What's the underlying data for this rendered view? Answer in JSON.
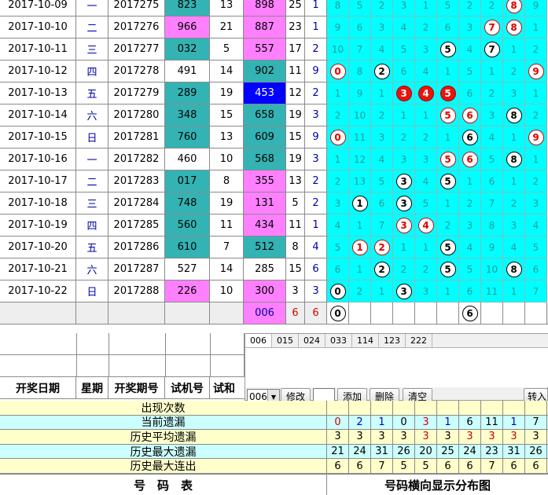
{
  "rows": [
    {
      "date": "2017-10-09",
      "weekday": "一",
      "issue": "2017275",
      "test": "823",
      "test_bg": "#33b3b3",
      "s1": "13",
      "win": "898",
      "win_bg": "#ff80ff",
      "s2": "25",
      "s3": "1"
    },
    {
      "date": "2017-10-10",
      "weekday": "二",
      "issue": "2017276",
      "test": "966",
      "test_bg": "#ff80ff",
      "s1": "21",
      "win": "887",
      "win_bg": "#ff80ff",
      "s2": "23",
      "s3": "1"
    },
    {
      "date": "2017-10-11",
      "weekday": "三",
      "issue": "2017277",
      "test": "032",
      "test_bg": "#33b3b3",
      "s1": "5",
      "win": "557",
      "win_bg": "#ff80ff",
      "s2": "17",
      "s3": "2"
    },
    {
      "date": "2017-10-12",
      "weekday": "四",
      "issue": "2017278",
      "test": "491",
      "test_bg": "#ffffff",
      "s1": "14",
      "win": "902",
      "win_bg": "#33b3b3",
      "s2": "11",
      "s3": "9"
    },
    {
      "date": "2017-10-13",
      "weekday": "五",
      "issue": "2017279",
      "test": "289",
      "test_bg": "#33b3b3",
      "s1": "19",
      "win": "453",
      "win_bg": "#0000ff",
      "s2": "12",
      "s3": "2"
    },
    {
      "date": "2017-10-14",
      "weekday": "六",
      "issue": "2017280",
      "test": "348",
      "test_bg": "#33b3b3",
      "s1": "15",
      "win": "658",
      "win_bg": "#33b3b3",
      "s2": "19",
      "s3": "3"
    },
    {
      "date": "2017-10-15",
      "weekday": "日",
      "issue": "2017281",
      "test": "760",
      "test_bg": "#33b3b3",
      "s1": "13",
      "win": "609",
      "win_bg": "#33b3b3",
      "s2": "15",
      "s3": "9"
    },
    {
      "date": "2017-10-16",
      "weekday": "一",
      "issue": "2017282",
      "test": "460",
      "test_bg": "#ffffff",
      "s1": "10",
      "win": "568",
      "win_bg": "#33b3b3",
      "s2": "19",
      "s3": "3"
    },
    {
      "date": "2017-10-17",
      "weekday": "二",
      "issue": "2017283",
      "test": "017",
      "test_bg": "#33b3b3",
      "s1": "8",
      "win": "355",
      "win_bg": "#ff80ff",
      "s2": "13",
      "s3": "2"
    },
    {
      "date": "2017-10-18",
      "weekday": "三",
      "issue": "2017284",
      "test": "748",
      "test_bg": "#33b3b3",
      "s1": "19",
      "win": "131",
      "win_bg": "#ff80ff",
      "s2": "5",
      "s3": "2"
    },
    {
      "date": "2017-10-19",
      "weekday": "四",
      "issue": "2017285",
      "test": "560",
      "test_bg": "#33b3b3",
      "s1": "11",
      "win": "434",
      "win_bg": "#ff80ff",
      "s2": "11",
      "s3": "1"
    },
    {
      "date": "2017-10-20",
      "weekday": "五",
      "issue": "2017286",
      "test": "610",
      "test_bg": "#33b3b3",
      "s1": "7",
      "win": "512",
      "win_bg": "#33b3b3",
      "s2": "8",
      "s3": "4"
    },
    {
      "date": "2017-10-21",
      "weekday": "六",
      "issue": "2017287",
      "test": "527",
      "test_bg": "#ffffff",
      "s1": "14",
      "win": "285",
      "win_bg": "#ffffff",
      "s2": "15",
      "s3": "6"
    },
    {
      "date": "2017-10-22",
      "weekday": "日",
      "issue": "2017288",
      "test": "226",
      "test_bg": "#ff80ff",
      "s1": "10",
      "win": "300",
      "win_bg": "#ff80ff",
      "s2": "3",
      "s3": "3"
    }
  ],
  "dist_rows": [
    [
      "8",
      "5",
      "2",
      "3",
      "1",
      "5",
      "2",
      "2",
      {
        "v": "8",
        "t": "red"
      },
      "9"
    ],
    [
      "9",
      "6",
      "3",
      "4",
      "2",
      "6",
      "3",
      {
        "v": "7",
        "t": "red"
      },
      {
        "v": "8",
        "t": "red"
      },
      "1"
    ],
    [
      "10",
      "7",
      "4",
      "5",
      "3",
      {
        "v": "5",
        "t": "white"
      },
      "4",
      {
        "v": "7",
        "t": "white"
      },
      "1",
      "2"
    ],
    [
      {
        "v": "0",
        "t": "red"
      },
      "8",
      {
        "v": "2",
        "t": "white"
      },
      "6",
      "4",
      "1",
      "5",
      "1",
      "2",
      {
        "v": "9",
        "t": "red"
      }
    ],
    [
      "1",
      "9",
      "1",
      {
        "v": "3",
        "t": "fill"
      },
      {
        "v": "4",
        "t": "fill"
      },
      {
        "v": "5",
        "t": "fill"
      },
      "6",
      "2",
      "3",
      "1"
    ],
    [
      "2",
      "10",
      "2",
      "1",
      "1",
      {
        "v": "5",
        "t": "red"
      },
      {
        "v": "6",
        "t": "red"
      },
      "3",
      {
        "v": "8",
        "t": "white"
      },
      "2"
    ],
    [
      {
        "v": "0",
        "t": "red"
      },
      "11",
      "3",
      "2",
      "2",
      "1",
      {
        "v": "6",
        "t": "white"
      },
      "4",
      "1",
      {
        "v": "9",
        "t": "red"
      }
    ],
    [
      "1",
      "12",
      "4",
      "3",
      "3",
      {
        "v": "5",
        "t": "red"
      },
      {
        "v": "6",
        "t": "red"
      },
      "5",
      {
        "v": "8",
        "t": "white"
      },
      "1"
    ],
    [
      "2",
      "13",
      "5",
      {
        "v": "3",
        "t": "white"
      },
      "4",
      {
        "v": "5",
        "t": "white"
      },
      "1",
      "6",
      "1",
      "2"
    ],
    [
      "3",
      {
        "v": "1",
        "t": "white"
      },
      "6",
      {
        "v": "3",
        "t": "white"
      },
      "5",
      "1",
      "2",
      "7",
      "2",
      "3"
    ],
    [
      "4",
      "1",
      "7",
      {
        "v": "3",
        "t": "red"
      },
      {
        "v": "4",
        "t": "red"
      },
      "2",
      "3",
      "8",
      "3",
      "4"
    ],
    [
      "5",
      {
        "v": "1",
        "t": "red"
      },
      {
        "v": "2",
        "t": "red"
      },
      "1",
      "1",
      {
        "v": "5",
        "t": "white"
      },
      "4",
      "9",
      "4",
      "5"
    ],
    [
      "6",
      "1",
      {
        "v": "2",
        "t": "white"
      },
      "2",
      "2",
      {
        "v": "5",
        "t": "white"
      },
      "5",
      "10",
      {
        "v": "8",
        "t": "white"
      },
      "6"
    ],
    [
      {
        "v": "0",
        "t": "white"
      },
      "2",
      "1",
      {
        "v": "3",
        "t": "white"
      },
      "3",
      "1",
      "6",
      "11",
      "1",
      "7"
    ]
  ],
  "pending_row": {
    "win": "006",
    "s2": "6",
    "s3": "6",
    "dist": [
      {
        "v": "0",
        "t": "white"
      },
      "",
      "",
      "",
      "",
      "",
      {
        "v": "6",
        "t": "white"
      },
      "",
      "",
      ""
    ]
  },
  "header": {
    "date": "开奖日期",
    "weekday": "星期",
    "issue": "开奖期号",
    "test": "试机号",
    "testsum": "试和"
  },
  "panel": {
    "tabs": [
      "006",
      "015",
      "024",
      "033",
      "114",
      "123",
      "222"
    ],
    "combo_value": "006",
    "btn_edit": "修改",
    "btn_add": "添加",
    "btn_delete": "删除",
    "btn_clear": "清空",
    "btn_transfer": "转入"
  },
  "stats": [
    {
      "label": "出现次数",
      "values": [
        "",
        "",
        "",
        "",
        "",
        "",
        "",
        "",
        "",
        ""
      ],
      "bg": "#ffffcc"
    },
    {
      "label": "当前遗漏",
      "values": [
        "0",
        "2",
        "1",
        "0",
        "3",
        "1",
        "6",
        "11",
        "1",
        "7"
      ],
      "bg": "#ccffff"
    },
    {
      "label": "历史平均遗漏",
      "values": [
        "3",
        "3",
        "3",
        "3",
        "3",
        "3",
        "3",
        "3",
        "3",
        "3"
      ],
      "bg": "#ffffcc"
    },
    {
      "label": "历史最大遗漏",
      "values": [
        "21",
        "24",
        "31",
        "26",
        "20",
        "25",
        "24",
        "23",
        "31",
        "26"
      ],
      "bg": "#ccffff"
    },
    {
      "label": "历史最大连出",
      "values": [
        "6",
        "6",
        "7",
        "5",
        "5",
        "6",
        "6",
        "7",
        "6",
        "6"
      ],
      "bg": "#ffffcc"
    }
  ],
  "stat_value_colors": [
    [
      "#000",
      "#000",
      "#000",
      "#000",
      "#000",
      "#000",
      "#000",
      "#000",
      "#000",
      "#000"
    ],
    [
      "#d00000",
      "#0000cc",
      "#0000cc",
      "#000",
      "#d00000",
      "#0000cc",
      "#000",
      "#000",
      "#0000cc",
      "#000"
    ],
    [
      "#000",
      "#000",
      "#000",
      "#000",
      "#d00000",
      "#000",
      "#d00000",
      "#d00000",
      "#d00000",
      "#000"
    ],
    [
      "#000",
      "#000",
      "#000",
      "#000",
      "#000",
      "#000",
      "#000",
      "#000",
      "#000",
      "#000"
    ],
    [
      "#000",
      "#000",
      "#000",
      "#000",
      "#000",
      "#000",
      "#000",
      "#000",
      "#000",
      "#000"
    ]
  ],
  "footer": {
    "left": "号　码　表",
    "right": "号码横向显示分布图"
  }
}
